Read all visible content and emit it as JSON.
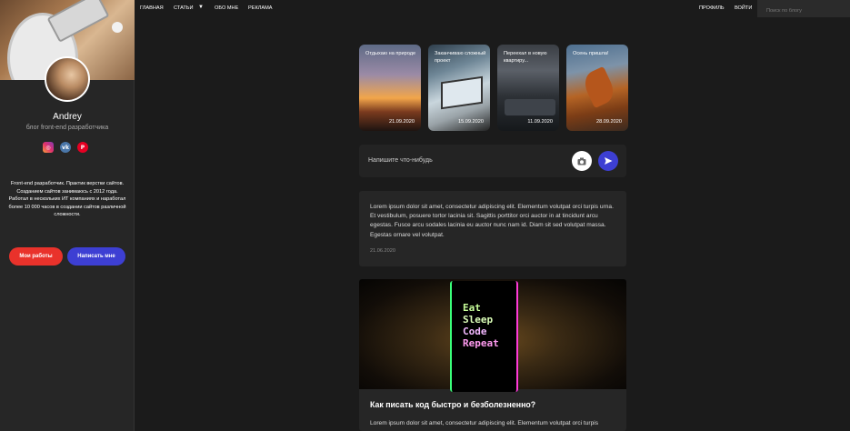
{
  "nav": {
    "home": "Главная",
    "articles": "Статьи",
    "about": "Обо мне",
    "ads": "Реклама",
    "profile": "Профиль",
    "login": "Войти",
    "search_placeholder": "Поиск по блогу"
  },
  "profile": {
    "name": "Andrey",
    "subtitle": "блог front-end разработчика",
    "bio": "Front-end разработчик. Практик верстки сайтов. Созданием сайтов занимаюсь с 2012 года. Работал в нескольких ИТ компаниях и наработал более 10 000 часов в создании сайтов различной сложности.",
    "socials": [
      "instagram-icon",
      "vk-icon",
      "pinterest-icon"
    ],
    "works_button": "Мои работы",
    "write_button": "Написать мне"
  },
  "stories": [
    {
      "title": "Отдыхаю на природе",
      "date": "21.09.2020"
    },
    {
      "title": "Заканчиваю сложный проект",
      "date": "15.09.2020"
    },
    {
      "title": "Переехал в новую квартиру...",
      "date": "11.09.2020"
    },
    {
      "title": "Осень пришла!",
      "date": "28.09.2020"
    }
  ],
  "composer": {
    "placeholder": "Напишите что-нибудь"
  },
  "posts": [
    {
      "text": "Lorem ipsum dolor sit amet, consectetur adipiscing elit. Elementum volutpat orci turpis urna. Et vestibulum, posuere tortor lacinia sit. Sagittis porttitor orci auctor in at tincidunt arcu egestas. Fusce arcu sodales lacinia eu auctor nunc nam id. Diam sit sed volutpat massa. Egestas ornare vel volutpat.",
      "date": "21.06.2020"
    },
    {
      "title": "Как писать код быстро и безболезненно?",
      "image_text": [
        "Eat",
        "Sleep",
        "Code",
        "Repeat"
      ],
      "text": "Lorem ipsum dolor sit amet, consectetur adipiscing elit. Elementum volutpat orci turpis"
    }
  ],
  "colors": {
    "accent_blue": "#3d3fd3",
    "accent_red": "#e9322b",
    "background": "#1b1b1b",
    "card": "#262626"
  }
}
